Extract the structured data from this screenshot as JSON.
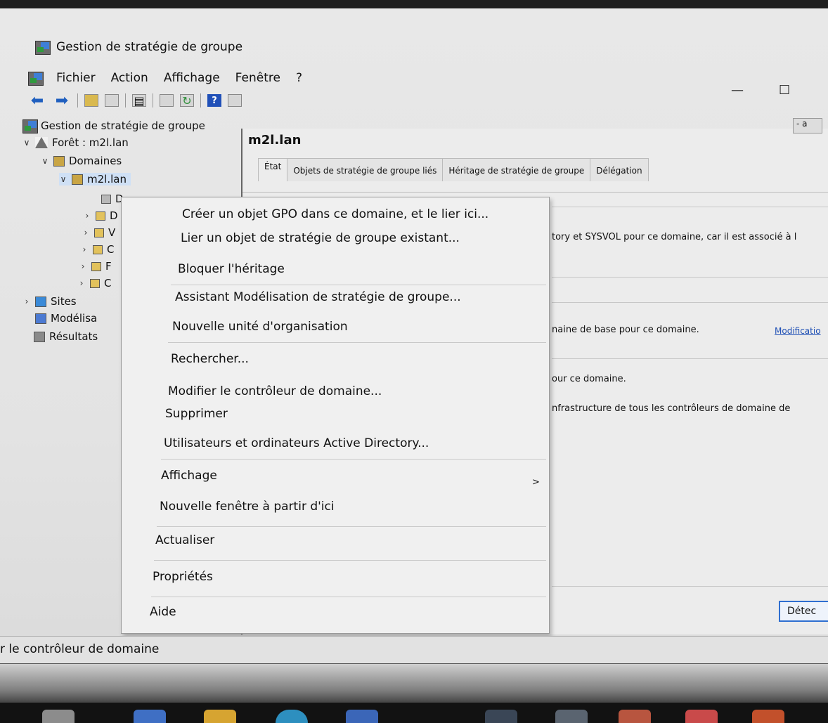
{
  "window": {
    "title": "Gestion de stratégie de groupe",
    "controls": {
      "minimize": "—",
      "maximize": "☐"
    }
  },
  "menubar": {
    "items": [
      "Fichier",
      "Action",
      "Affichage",
      "Fenêtre",
      "?"
    ]
  },
  "toolbar": {
    "buttons": [
      "back-arrow",
      "forward-arrow",
      "up-folder",
      "show-tree",
      "properties",
      "export",
      "refresh",
      "help",
      "mmc-view"
    ]
  },
  "tree": {
    "root": "Gestion de stratégie de groupe",
    "forest": "Forêt : m2l.lan",
    "domains": "Domaines",
    "domain": "m2l.lan",
    "children": [
      "D",
      "D",
      "V",
      "C",
      "F",
      "C"
    ],
    "sites": "Sites",
    "modeling": "Modélisa",
    "results": "Résultats"
  },
  "rightpane": {
    "title": "m2l.lan",
    "tabs": [
      "État",
      "Objets de stratégie de groupe liés",
      "Héritage de stratégie de groupe",
      "Délégation"
    ],
    "lines": [
      "tory et SYSVOL pour ce domaine, car il est associé à l",
      "naine de base pour ce domaine.",
      "our ce domaine.",
      "nfrastructure de tous les contrôleurs de domaine de"
    ],
    "link": "Modificatio",
    "scroll_hint": "- a",
    "detect_button": "Détec"
  },
  "context_menu": {
    "items": [
      "Créer un objet GPO dans ce domaine, et le lier ici...",
      "Lier un objet de stratégie de groupe existant...",
      "Bloquer l'héritage",
      "Assistant Modélisation de stratégie de groupe...",
      "Nouvelle unité d'organisation",
      "Rechercher...",
      "Modifier le contrôleur de domaine...",
      "Supprimer",
      "Utilisateurs et ordinateurs Active Directory...",
      "Affichage",
      "Nouvelle fenêtre à partir d'ici",
      "Actualiser",
      "Propriétés",
      "Aide"
    ],
    "submenu_arrow": ">"
  },
  "statusbar": {
    "text": "r le contrôleur de domaine"
  },
  "colors": {
    "link": "#1e4fb5",
    "detect_border": "#2f6fd0",
    "toolbar_arrow": "#1f5fbf"
  }
}
